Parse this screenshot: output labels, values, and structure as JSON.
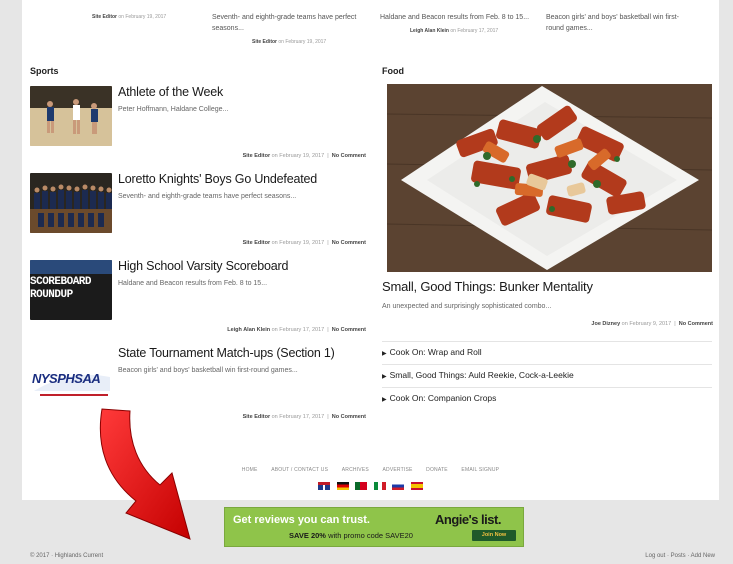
{
  "top_row": [
    {
      "text": "",
      "author": "Site Editor",
      "date": "on February 19, 2017"
    },
    {
      "text": "Seventh- and eighth-grade teams have perfect seasons...",
      "author": "Site Editor",
      "date": "on February 19, 2017"
    },
    {
      "text": "Haldane and Beacon results from Feb. 8 to 15...",
      "author": "Leigh Alan Klein",
      "date": "on February 17, 2017"
    },
    {
      "text": "Beacon girls' and boys' basketball win first-round games...",
      "author": "",
      "date": ""
    }
  ],
  "sports": {
    "title": "Sports",
    "articles": [
      {
        "title": "Athlete of the Week",
        "excerpt": "Peter Hoffmann, Haldane College...",
        "author": "Site Editor",
        "date": "on February 19, 2017",
        "comments": "No Comment"
      },
      {
        "title": "Loretto Knights' Boys Go Undefeated",
        "excerpt": "Seventh- and eighth-grade teams have perfect seasons...",
        "author": "Site Editor",
        "date": "on February 19, 2017",
        "comments": "No Comment"
      },
      {
        "title": "High School Varsity Scoreboard",
        "excerpt": "Haldane and Beacon results from Feb. 8 to 15...",
        "author": "Leigh Alan Klein",
        "date": "on February 17, 2017",
        "comments": "No Comment"
      },
      {
        "title": "State Tournament Match-ups (Section 1)",
        "excerpt": "Beacon girls' and boys' basketball win first-round games...",
        "author": "Site Editor",
        "date": "on February 17, 2017",
        "comments": "No Comment"
      }
    ],
    "thumb_text": {
      "scoreboard": "SCOREBOARD ROUNDUP",
      "nysphsaa": "NYSPHSAA"
    }
  },
  "food": {
    "title": "Food",
    "feature": {
      "title": "Small, Good Things: Bunker Mentality",
      "excerpt": "An unexpected and surprisingly sophisticated combo...",
      "author": "Joe Dizney",
      "date": "on February 9, 2017",
      "comments": "No Comment"
    },
    "links": [
      "Cook On: Wrap and Roll",
      "Small, Good Things: Auld Reekie, Cock-a-Leekie",
      "Cook On: Companion Crops"
    ]
  },
  "footer": {
    "links": [
      "HOME",
      "ABOUT / CONTACT US",
      "ARCHIVES",
      "ADVERTISE",
      "DONATE",
      "EMAIL SIGNUP"
    ]
  },
  "ad": {
    "line1": "Get reviews you can trust.",
    "brand": "Angie's list.",
    "line2_prefix": "SAVE 20%",
    "line2_rest": "with promo code SAVE20",
    "button": "Join Now"
  },
  "bottom": {
    "left": "© 2017 · Highlands Current",
    "right": "Log out · Posts · Add New"
  },
  "colors": {
    "ad_green": "#8fc44a",
    "arrow_red": "#e01010"
  }
}
